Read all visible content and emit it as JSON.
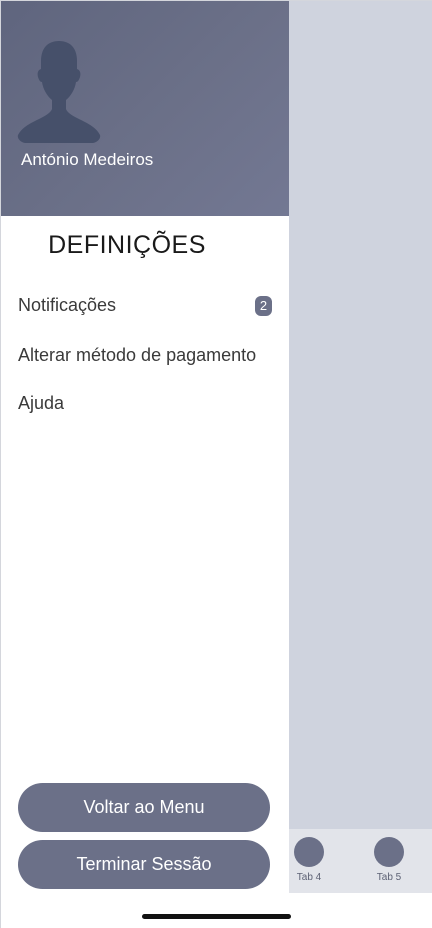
{
  "drawer": {
    "user_name": "António Medeiros",
    "section_title": "DEFINIÇÕES",
    "items": [
      {
        "label": "Notificações",
        "badge": "2"
      },
      {
        "label": "Alterar método de pagamento"
      },
      {
        "label": "Ajuda"
      }
    ],
    "back_button": "Voltar ao Menu",
    "logout_button": "Terminar Sessão"
  },
  "tabbar": {
    "tabs": [
      {
        "label": "Tab 4"
      },
      {
        "label": "Tab 5"
      }
    ]
  },
  "colors": {
    "accent": "#6b7088",
    "header_bg": "#656a83",
    "background_app": "#cfd3de",
    "tabbar_bg": "#e2e4ea"
  },
  "icons": {
    "avatar": "user-silhouette-icon"
  }
}
